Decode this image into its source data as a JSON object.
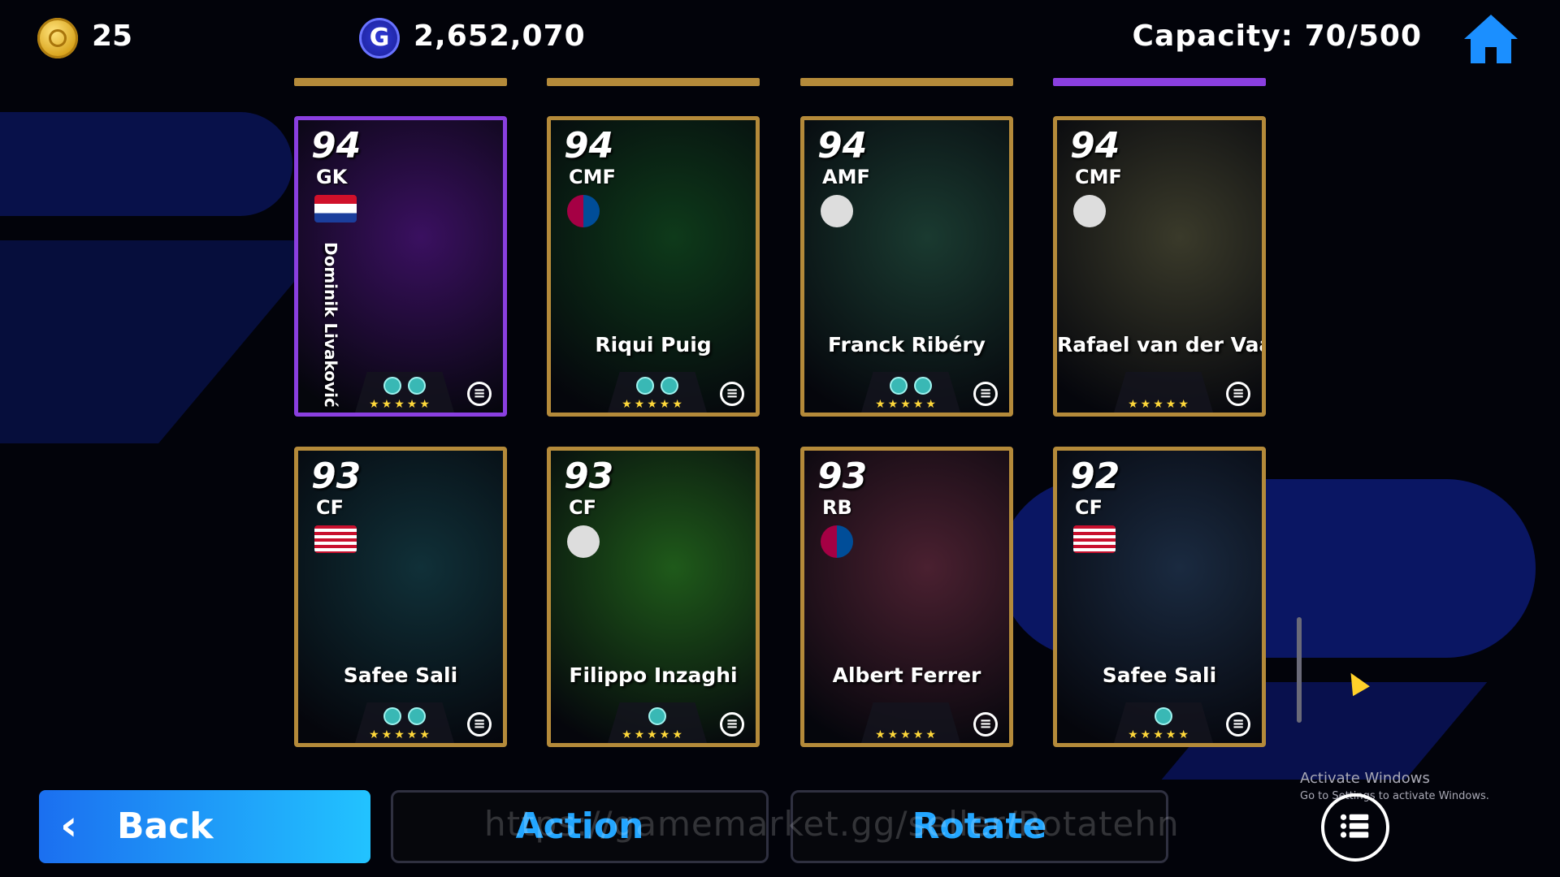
{
  "header": {
    "coins": "25",
    "gp": "2,652,070",
    "capacity": "Capacity: 70/500"
  },
  "cards": [
    {
      "rating": "94",
      "position": "GK",
      "name": "Dominik Livaković",
      "badge": "croatia-flag",
      "stars": "★★★★★",
      "skills": 2,
      "frame": "#8a3fe0",
      "bg": "#3a1060"
    },
    {
      "rating": "94",
      "position": "CMF",
      "name": "Riqui Puig",
      "badge": "fc-barcelona-crest",
      "stars": "★★★★★",
      "skills": 2,
      "frame": "#b48a3a",
      "bg": "#0e3a1a"
    },
    {
      "rating": "94",
      "position": "AMF",
      "name": "Franck Ribéry",
      "badge": "club-crest",
      "stars": "★★★★★",
      "skills": 2,
      "frame": "#b48a3a",
      "bg": "#1a3a30"
    },
    {
      "rating": "94",
      "position": "CMF",
      "name": "Rafael van der Vaart",
      "badge": "club-crest",
      "stars": "★★★★★",
      "skills": 0,
      "frame": "#b48a3a",
      "bg": "#3a3a2a"
    },
    {
      "rating": "93",
      "position": "CF",
      "name": "Safee Sali",
      "badge": "malaysia-flag",
      "stars": "★★★★★",
      "skills": 2,
      "frame": "#b48a3a",
      "bg": "#103038"
    },
    {
      "rating": "93",
      "position": "CF",
      "name": "Filippo Inzaghi",
      "badge": "club-crest",
      "stars": "★★★★★",
      "skills": 1,
      "frame": "#b48a3a",
      "bg": "#1f5a1a"
    },
    {
      "rating": "93",
      "position": "RB",
      "name": "Albert Ferrer",
      "badge": "fc-barcelona-crest",
      "stars": "★★★★★",
      "skills": 0,
      "frame": "#b48a3a",
      "bg": "#4a2030"
    },
    {
      "rating": "92",
      "position": "CF",
      "name": "Safee Sali",
      "badge": "malaysia-flag",
      "stars": "★★★★★",
      "skills": 1,
      "frame": "#b48a3a",
      "bg": "#1a2a40"
    }
  ],
  "footer": {
    "back_label": "Back",
    "action_label": "Action",
    "rotate_label": "Rotate",
    "watermark": "https://gamemarket.gg/seller/Rotatehn",
    "activate_title": "Activate Windows",
    "activate_sub": "Go to Settings to activate Windows."
  },
  "icons": {
    "coin": "coin-icon",
    "gp": "gp-icon",
    "home": "home-icon",
    "menu": "list-menu-icon",
    "back": "chevron-left-icon"
  },
  "colors": {
    "accent_blue": "#1b9cff",
    "gold_frame": "#b48a3a",
    "purple_frame": "#8a3fe0",
    "star": "#ffd83a"
  }
}
